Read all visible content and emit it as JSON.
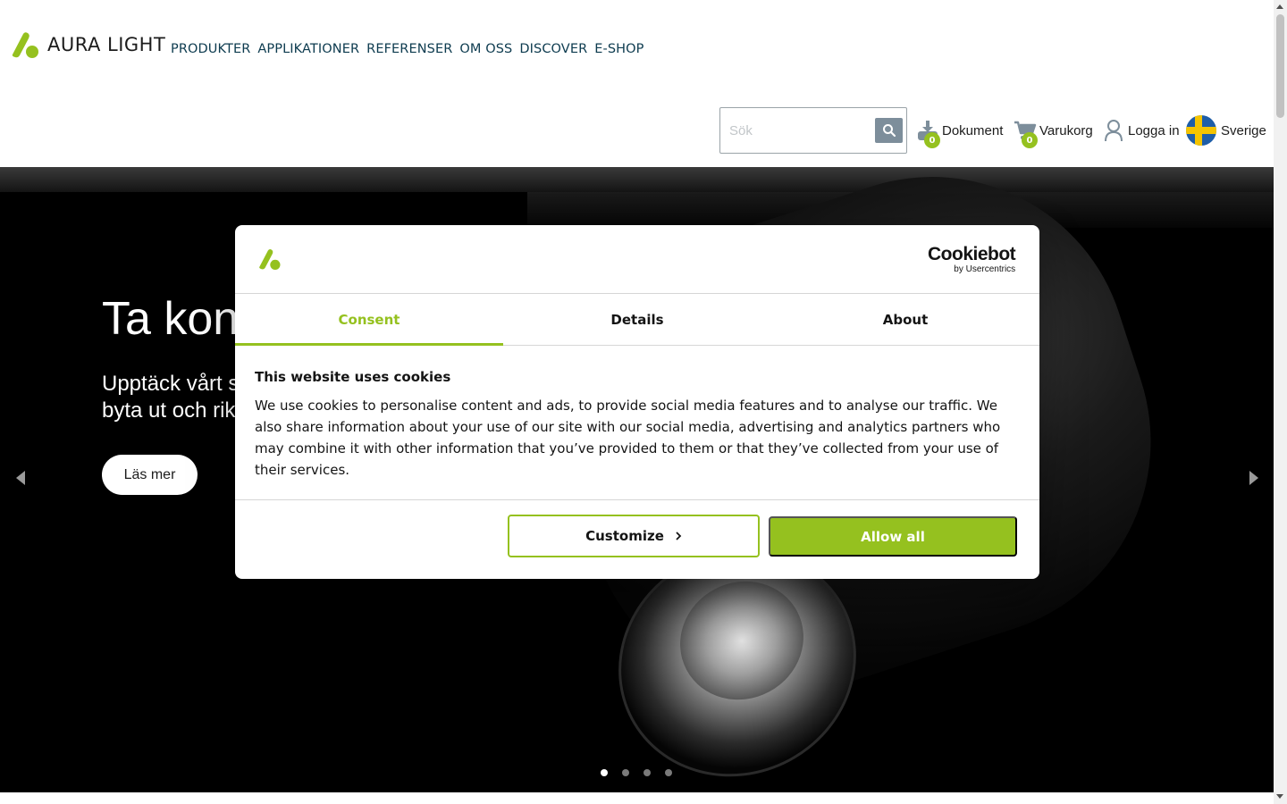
{
  "header": {
    "logo_text": "AURA LIGHT",
    "nav": [
      "PRODUKTER",
      "APPLIKATIONER",
      "REFERENSER",
      "OM OSS",
      "DISCOVER",
      "E-SHOP"
    ],
    "search_placeholder": "Sök",
    "documents_label": "Dokument",
    "documents_count": "0",
    "cart_label": "Varukorg",
    "cart_count": "0",
    "login_label": "Logga in",
    "country_label": "Sverige"
  },
  "hero": {
    "title": "Ta kon",
    "subtitle_line1": "Upptäck vårt s",
    "subtitle_line2": "byta ut och rik",
    "button_label": "Läs mer",
    "slide_count": 4,
    "active_slide": 1
  },
  "cookie_dialog": {
    "brand_name": "Cookiebot",
    "brand_by": "by Usercentrics",
    "tabs": [
      "Consent",
      "Details",
      "About"
    ],
    "active_tab": "Consent",
    "title": "This website uses cookies",
    "body": "We use cookies to personalise content and ads, to provide social media features and to analyse our traffic. We also share information about your use of our site with our social media, advertising and analytics partners who may combine it with other information that you’ve provided to them or that they’ve collected from your use of their services.",
    "customize_label": "Customize",
    "allow_label": "Allow all"
  },
  "colors": {
    "accent": "#95c11f",
    "nav_text": "#0d3b4f",
    "search_button": "#7d8e9b"
  },
  "icons": {
    "logo": "aura-light-logo-icon",
    "search": "search-icon",
    "documents": "document-download-icon",
    "cart": "shopping-cart-icon",
    "user": "user-icon",
    "flag": "sweden-flag-icon",
    "chevron": "chevron-right-icon"
  }
}
